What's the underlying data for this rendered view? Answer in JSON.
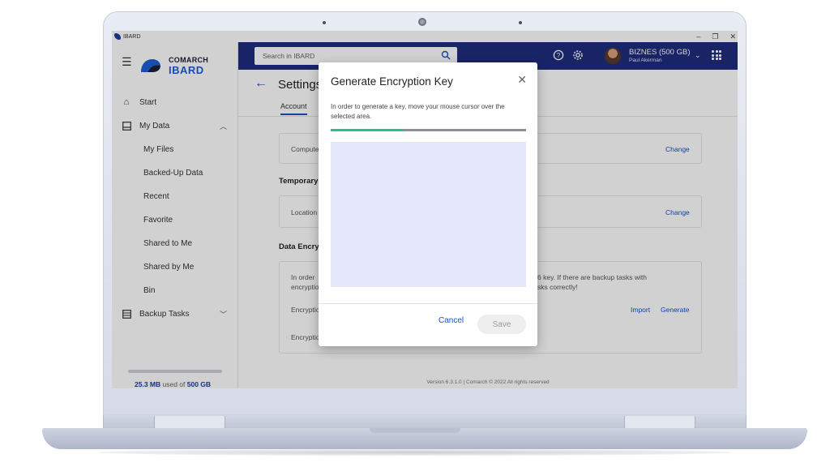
{
  "window": {
    "title": "IBARD"
  },
  "brand": {
    "top": "COMARCH",
    "bottom": "IBARD"
  },
  "sidebar": {
    "items": [
      {
        "label": "Start"
      },
      {
        "label": "My Data"
      },
      {
        "label": "My Files"
      },
      {
        "label": "Backed-Up Data"
      },
      {
        "label": "Recent"
      },
      {
        "label": "Favorite"
      },
      {
        "label": "Shared to Me"
      },
      {
        "label": "Shared by Me"
      },
      {
        "label": "Bin"
      },
      {
        "label": "Backup Tasks"
      }
    ],
    "quota": {
      "used": "25.3 MB",
      "middle": " used of ",
      "total": "500 GB",
      "fraction": 0.0
    }
  },
  "topbar": {
    "search_placeholder": "Search in IBARD",
    "account_plan": "BIZNES (500 GB)",
    "account_user": "Paul Akerman"
  },
  "main": {
    "page_title": "Settings",
    "tab": "Account",
    "card1_label": "Compute",
    "change1": "Change",
    "section_temporary": "Temporary",
    "card2_label": "Location",
    "change2": "Change",
    "section_encryption": "Data Encryp",
    "enc_text_left_1": "In order",
    "enc_text_left_2": "encryptio",
    "enc_text_right_1": "6 key. If there are backup tasks with",
    "enc_text_right_2": "sks correctly!",
    "enc_row1_label": "Encryptio",
    "import": "Import",
    "generate": "Generate",
    "enc_row2_label": "Encryptio",
    "version": "Version 6.3.1.0  |  Comarch © 2022 All rights reserved"
  },
  "dialog": {
    "title": "Generate Encryption Key",
    "text": "In order to generate a key, move your mouse cursor over the selected area.",
    "progress": 0.37,
    "cancel": "Cancel",
    "save": "Save"
  },
  "colors": {
    "topbar": "#1e2d7d",
    "accent": "#1c4fc7",
    "progress": "#27c08a",
    "capture_area": "#e4e6f9"
  }
}
